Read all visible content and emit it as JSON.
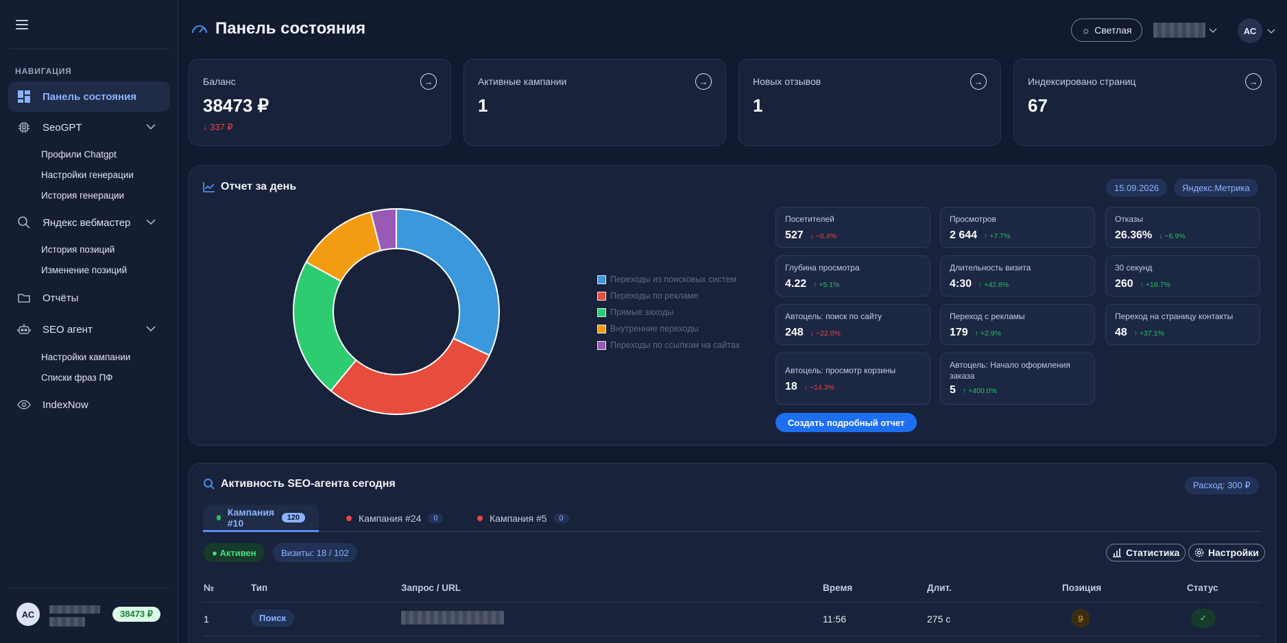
{
  "sidebar": {
    "heading": "НАВИГАЦИЯ",
    "items": [
      {
        "label": "Панель состояния",
        "icon": "dashboard-icon",
        "active": true
      },
      {
        "label": "SeoGPT",
        "icon": "chip-icon"
      },
      {
        "label": "Яндекс вебмастер",
        "icon": "search-icon"
      },
      {
        "label": "Отчёты",
        "icon": "folder-icon"
      },
      {
        "label": "SEO агент",
        "icon": "robot-icon"
      },
      {
        "label": "IndexNow",
        "icon": "eye-icon"
      }
    ],
    "seogpt_sub": [
      "Профили Chatgpt",
      "Настройки генерации",
      "История генерации"
    ],
    "webmaster_sub": [
      "История позиций",
      "Изменение позиций"
    ],
    "agent_sub": [
      "Настройки кампании",
      "Списки фраз ПФ"
    ],
    "footer": {
      "avatar": "АС",
      "balance": "38473 ₽"
    }
  },
  "header": {
    "title": "Панель состояния",
    "theme_label": "Светлая",
    "user_initials": "АС"
  },
  "stats": [
    {
      "title": "Баланс",
      "value": "38473 ₽",
      "delta": "↓ 337 ₽"
    },
    {
      "title": "Активные кампании",
      "value": "1",
      "delta": ""
    },
    {
      "title": "Новых отзывов",
      "value": "1",
      "delta": ""
    },
    {
      "title": "Индексировано страниц",
      "value": "67",
      "delta": ""
    }
  ],
  "report": {
    "title": "Отчет за день",
    "date": "15.09.2026",
    "source": "Яндекс.Метрика",
    "create_button": "Создать подробный отчет",
    "metrics": [
      {
        "title": "Посетителей",
        "value": "527",
        "delta": "↓ −0.4%",
        "dir": "down"
      },
      {
        "title": "Просмотров",
        "value": "2 644",
        "delta": "↑ +7.7%",
        "dir": "up"
      },
      {
        "title": "Отказы",
        "value": "26.36%",
        "delta": "↓ −6.9%",
        "dir": "up"
      },
      {
        "title": "Глубина просмотра",
        "value": "4.22",
        "delta": "↑ +5.1%",
        "dir": "up"
      },
      {
        "title": "Длительность визита",
        "value": "4:30",
        "delta": "↑ +42.8%",
        "dir": "up"
      },
      {
        "title": "30 секунд",
        "value": "260",
        "delta": "↑ +18.7%",
        "dir": "up"
      },
      {
        "title": "Автоцель: поиск по сайту",
        "value": "248",
        "delta": "↓ −22.0%",
        "dir": "down"
      },
      {
        "title": "Переход с рекламы",
        "value": "179",
        "delta": "↑ +2.9%",
        "dir": "up"
      },
      {
        "title": "Переход на страницу контакты",
        "value": "48",
        "delta": "↑ +37.1%",
        "dir": "up"
      },
      {
        "title": "Автоцель: просмотр корзины",
        "value": "18",
        "delta": "↓ −14.3%",
        "dir": "down"
      },
      {
        "title": "Автоцель: Начало оформления заказа",
        "value": "5",
        "delta": "↑ +400.0%",
        "dir": "up"
      }
    ]
  },
  "chart_data": {
    "type": "pie",
    "categories": [
      "Переходы из поисковых систем",
      "Переходы по рекламе",
      "Прямые заходы",
      "Внутренние переходы",
      "Переходы по ссылкам на сайтах"
    ],
    "values": [
      32,
      29,
      22,
      13,
      4
    ],
    "colors": [
      "#3b98dc",
      "#e74c3c",
      "#2ecc71",
      "#f39c12",
      "#9b59b6"
    ],
    "legend": "right"
  },
  "agent": {
    "title": "Активность SEO-агента сегодня",
    "expense": "Расход: 300 ₽",
    "tabs": [
      {
        "label": "Кампания #10",
        "count": "120",
        "color": "#22c55e"
      },
      {
        "label": "Кампания #24",
        "count": "0",
        "color": "#ef4444"
      },
      {
        "label": "Кампания #5",
        "count": "0",
        "color": "#ef4444"
      }
    ],
    "status": "● Активен",
    "visits": "Визиты: 18 / 102",
    "stats_button": "Статистика",
    "settings_button": "Настройки",
    "columns": [
      "№",
      "Тип",
      "Запрос / URL",
      "Время",
      "Длит.",
      "Позиция",
      "Статус"
    ],
    "rows": [
      {
        "num": "1",
        "type": "Поиск",
        "time": "11:56",
        "duration": "275 с",
        "position": "9",
        "status": "✓"
      }
    ]
  }
}
